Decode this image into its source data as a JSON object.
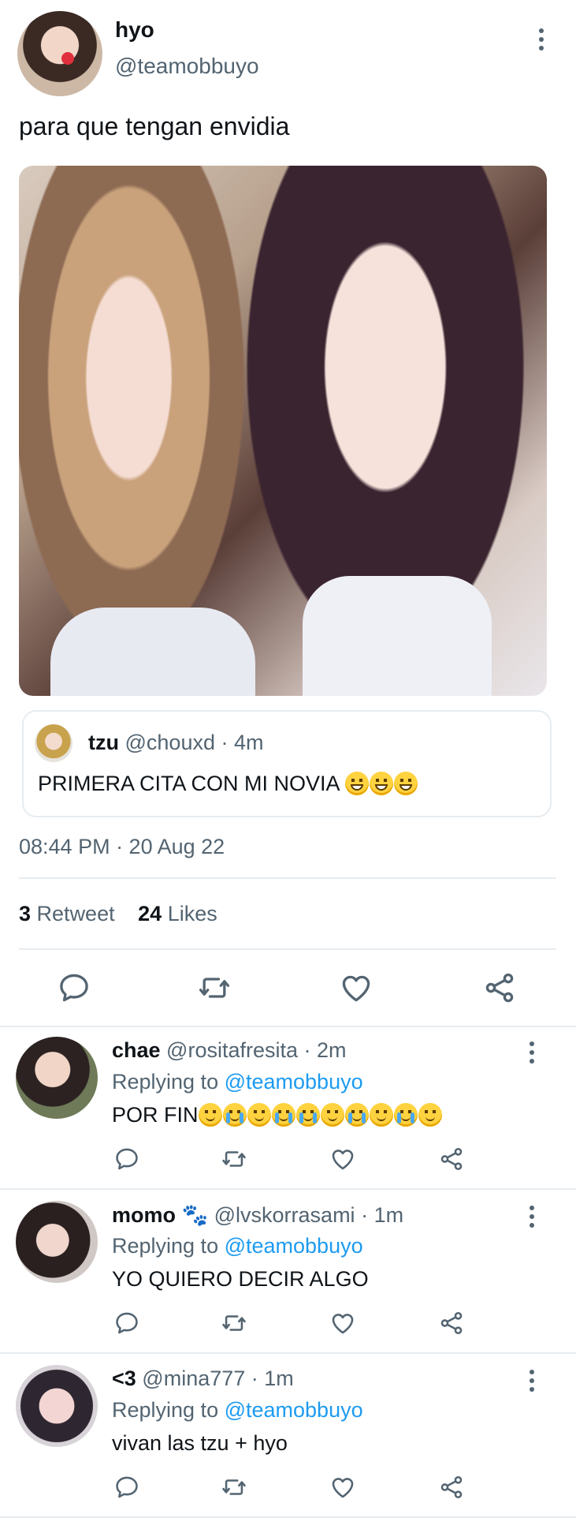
{
  "tweet": {
    "author_name": "hyo",
    "author_handle": "@teamobbuyo",
    "text": "para que tengan envidia",
    "quote": {
      "name": "tzu",
      "handle": "@chouxd",
      "sep": " · ",
      "time": "4m",
      "text": "PRIMERA CITA CON MI NOVIA",
      "emoji": [
        "grin-icon",
        "grin-icon",
        "grin-icon"
      ]
    },
    "timestamp": "08:44 PM · 20 Aug 22",
    "stats": {
      "retweets": "3",
      "retweets_label": "Retweet",
      "likes": "24",
      "likes_label": "Likes"
    },
    "actions": [
      "reply-icon",
      "retweet-icon",
      "like-icon",
      "share-icon"
    ]
  },
  "replies": [
    {
      "name": "chae",
      "emoji_after_name": "",
      "handle": "@rositafresita",
      "time": "2m",
      "replying_label": "Replying to",
      "replying_handle": "@teamobbuyo",
      "text": "POR FIN",
      "emoji": [
        "smile-icon",
        "cry-icon",
        "smile-icon",
        "cry-icon",
        "cry-icon",
        "smile-icon",
        "cry-icon",
        "smile-icon",
        "cry-icon",
        "smile-icon"
      ]
    },
    {
      "name": "momo",
      "emoji_after_name": "🐾",
      "handle": "@lvskorrasami",
      "time": "1m",
      "replying_label": "Replying to",
      "replying_handle": "@teamobbuyo",
      "text": "YO QUIERO DECIR ALGO",
      "emoji": []
    },
    {
      "name": "<3",
      "emoji_after_name": "",
      "handle": "@mina777",
      "time": "1m",
      "replying_label": "Replying to",
      "replying_handle": "@teamobbuyo",
      "text": "vivan las tzu + hyo",
      "emoji": []
    }
  ],
  "colors": {
    "text": "#0f1419",
    "muted": "#536471",
    "link": "#1d9bf0",
    "divider": "#e6ecf0"
  }
}
